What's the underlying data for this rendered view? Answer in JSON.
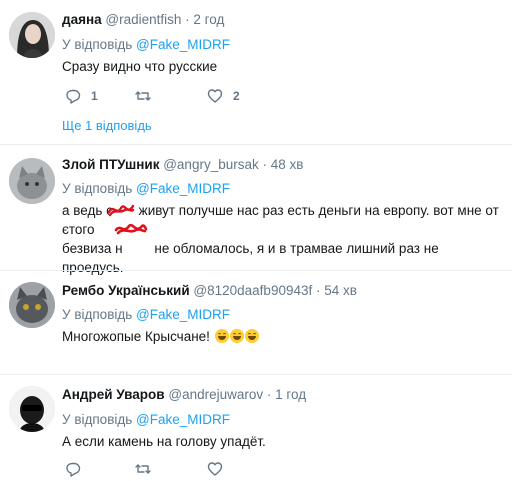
{
  "tweets": [
    {
      "name": "даяна",
      "handle": "@radientfish",
      "time": "2 год",
      "reply_prefix": "У відповідь",
      "reply_to": "@Fake_MIDRF",
      "text": "Сразу видно что русские",
      "replies": "1",
      "retweets": "",
      "likes": "2",
      "more": "Ще 1 відповідь"
    },
    {
      "name": "Злой ПТУшник",
      "handle": "@angry_bursak",
      "time": "48 хв",
      "reply_prefix": "У відповідь",
      "reply_to": "@Fake_MIDRF",
      "line1a": "а ведь с",
      "line1b": " живут получше нас раз есть деньги на европу. вот мне от єтого",
      "line2a": "безвиза н",
      "line2b": " не обломалось, я и в трамвае лишний раз не проедусь."
    },
    {
      "name": "Рембо Український",
      "handle": "@8120daafb90943f",
      "time": "54 хв",
      "reply_prefix": "У відповідь",
      "reply_to": "@Fake_MIDRF",
      "text": "Многожопые Крысчане!"
    },
    {
      "name": "Андрей Уваров",
      "handle": "@andrejuwarov",
      "time": "1 год",
      "reply_prefix": "У відповідь",
      "reply_to": "@Fake_MIDRF",
      "text": "А если камень на голову упадёт."
    }
  ],
  "separator": " · ",
  "icons": {
    "reply": "reply-icon",
    "retweet": "retweet-icon",
    "like": "heart-icon",
    "emoji": "tears-of-joy-emoji"
  },
  "colors": {
    "link": "#1da1f2",
    "muted": "#657786",
    "divider": "#e6ecf0",
    "redaction": "#e0101c"
  }
}
